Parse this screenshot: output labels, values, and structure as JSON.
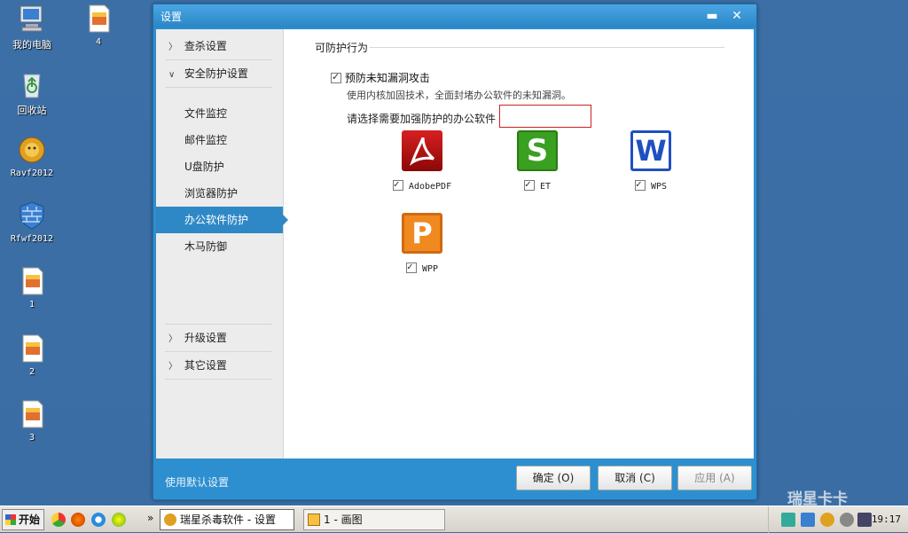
{
  "desktop": {
    "icons": [
      {
        "label": "我的电脑"
      },
      {
        "label": "4"
      },
      {
        "label": "回收站"
      },
      {
        "label": "Ravf2012"
      },
      {
        "label": "Rfwf2012"
      },
      {
        "label": "1"
      },
      {
        "label": "2"
      },
      {
        "label": "3"
      }
    ]
  },
  "window": {
    "title": "设置",
    "minimize": "▬",
    "close": "✕"
  },
  "nav": {
    "groups": [
      {
        "label": "查杀设置"
      },
      {
        "label": "安全防护设置"
      },
      {
        "label": "升级设置"
      },
      {
        "label": "其它设置"
      }
    ],
    "items": [
      {
        "label": "文件监控"
      },
      {
        "label": "邮件监控"
      },
      {
        "label": "U盘防护"
      },
      {
        "label": "浏览器防护"
      },
      {
        "label": "办公软件防护"
      },
      {
        "label": "木马防御"
      }
    ]
  },
  "content": {
    "section_title": "可防护行为",
    "option_label": "预防未知漏洞攻击",
    "option_checked": true,
    "option_desc": "使用内核加固技术，全面封堵办公软件的未知漏洞。",
    "pick_label": "请选择需要加强防护的办公软件",
    "apps": [
      {
        "label": "AdobePDF",
        "icon": "adobe-pdf-icon",
        "checked": true,
        "color": "#c01010"
      },
      {
        "label": "ET",
        "icon": "et-spreadsheet-icon",
        "checked": true,
        "color": "#3fa020"
      },
      {
        "label": "WPS",
        "icon": "wps-writer-icon",
        "checked": true,
        "color": "#2050c0"
      },
      {
        "label": "WPP",
        "icon": "wpp-presentation-icon",
        "checked": true,
        "color": "#f08020"
      }
    ]
  },
  "footer": {
    "default_link": "使用默认设置",
    "ok": "确定 (O)",
    "cancel": "取消 (C)",
    "apply": "应用 (A)"
  },
  "taskbar": {
    "start": "开始",
    "tasks": [
      {
        "label": "瑞星杀毒软件 - 设置"
      },
      {
        "label": "1 - 画图"
      }
    ],
    "overflow": "»",
    "clock": "19:17"
  },
  "watermark": "瑞星卡卡"
}
